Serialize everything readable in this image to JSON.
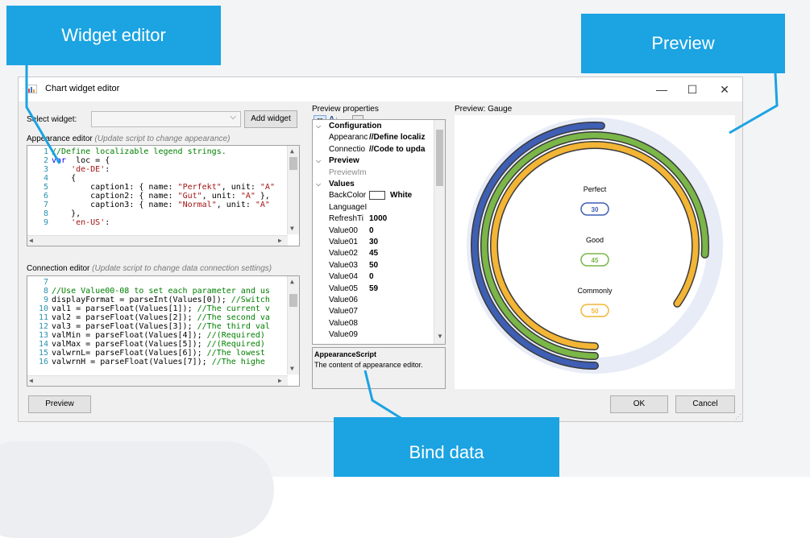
{
  "callouts": {
    "widget_editor": "Widget editor",
    "preview": "Preview",
    "bind_data": "Bind data"
  },
  "window": {
    "title": "Chart widget editor",
    "minimize": "—",
    "maximize": "☐",
    "close": "✕"
  },
  "select_widget": {
    "label": "Select widget:",
    "value": "",
    "add_button": "Add widget"
  },
  "appearance": {
    "label": "Appearance editor",
    "hint": "(Update script to change appearance)",
    "lines": [
      {
        "n": "1",
        "parts": [
          [
            "cm",
            "//Define localizable legend strings."
          ]
        ]
      },
      {
        "n": "2",
        "parts": [
          [
            "kw",
            "var"
          ],
          [
            "",
            "  loc = {"
          ]
        ]
      },
      {
        "n": "3",
        "parts": [
          [
            "st",
            "    'de-DE'"
          ],
          [
            "",
            ":"
          ]
        ]
      },
      {
        "n": "4",
        "parts": [
          [
            "",
            "    {"
          ]
        ]
      },
      {
        "n": "5",
        "parts": [
          [
            "",
            "        caption1: { name: "
          ],
          [
            "st",
            "\"Perfekt\""
          ],
          [
            "",
            ", unit: "
          ],
          [
            "st",
            "\"A\""
          ]
        ]
      },
      {
        "n": "6",
        "parts": [
          [
            "",
            "        caption2: { name: "
          ],
          [
            "st",
            "\"Gut\""
          ],
          [
            "",
            ", unit: "
          ],
          [
            "st",
            "\"A\""
          ],
          [
            "",
            " },"
          ]
        ]
      },
      {
        "n": "7",
        "parts": [
          [
            "",
            "        caption3: { name: "
          ],
          [
            "st",
            "\"Normal\""
          ],
          [
            "",
            ", unit: "
          ],
          [
            "st",
            "\"A\""
          ]
        ]
      },
      {
        "n": "8",
        "parts": [
          [
            "",
            "    },"
          ]
        ]
      },
      {
        "n": "9",
        "parts": [
          [
            "st",
            "    'en-US'"
          ],
          [
            "",
            ":"
          ]
        ]
      }
    ]
  },
  "connection": {
    "label": "Connection editor",
    "hint": "(Update script to change data connection settings)",
    "lines": [
      {
        "n": "7",
        "parts": []
      },
      {
        "n": "8",
        "parts": [
          [
            "cm",
            "//Use Value00-08 to set each parameter and us"
          ]
        ]
      },
      {
        "n": "9",
        "parts": [
          [
            "",
            "displayFormat = parseInt(Values[0]); "
          ],
          [
            "cm",
            "//Switch"
          ]
        ]
      },
      {
        "n": "10",
        "parts": [
          [
            "",
            "val1 = parseFloat(Values[1]); "
          ],
          [
            "cm",
            "//The current v"
          ]
        ]
      },
      {
        "n": "11",
        "parts": [
          [
            "",
            "val2 = parseFloat(Values[2]); "
          ],
          [
            "cm",
            "//The second va"
          ]
        ]
      },
      {
        "n": "12",
        "parts": [
          [
            "",
            "val3 = parseFloat(Values[3]); "
          ],
          [
            "cm",
            "//The third val"
          ]
        ]
      },
      {
        "n": "13",
        "parts": [
          [
            "",
            "valMin = parseFloat(Values[4]); "
          ],
          [
            "cm",
            "//(Required)"
          ]
        ]
      },
      {
        "n": "14",
        "parts": [
          [
            "",
            "valMax = parseFloat(Values[5]); "
          ],
          [
            "cm",
            "//(Required)"
          ]
        ]
      },
      {
        "n": "15",
        "parts": [
          [
            "",
            "valwrnL= parseFloat(Values[6]); "
          ],
          [
            "cm",
            "//The lowest"
          ]
        ]
      },
      {
        "n": "16",
        "parts": [
          [
            "",
            "valwrnH = parseFloat(Values[7]); "
          ],
          [
            "cm",
            "//The highe"
          ]
        ]
      }
    ]
  },
  "preview_button": "Preview",
  "properties": {
    "label": "Preview properties",
    "rows": [
      {
        "type": "cat",
        "name": "Configuration"
      },
      {
        "type": "prop",
        "name": "Appearanc",
        "value": "//Define localiz"
      },
      {
        "type": "prop",
        "name": "Connectio",
        "value": "//Code to upda"
      },
      {
        "type": "cat",
        "name": "Preview"
      },
      {
        "type": "prop",
        "name": "PreviewIm",
        "value": "",
        "grey": true
      },
      {
        "type": "cat",
        "name": "Values"
      },
      {
        "type": "color",
        "name": "BackColor",
        "value": "White"
      },
      {
        "type": "prop",
        "name": "LanguageI",
        "value": ""
      },
      {
        "type": "prop",
        "name": "RefreshTi",
        "value": "1000"
      },
      {
        "type": "prop",
        "name": "Value00",
        "value": "0"
      },
      {
        "type": "prop",
        "name": "Value01",
        "value": "30"
      },
      {
        "type": "prop",
        "name": "Value02",
        "value": "45"
      },
      {
        "type": "prop",
        "name": "Value03",
        "value": "50"
      },
      {
        "type": "prop",
        "name": "Value04",
        "value": "0"
      },
      {
        "type": "prop",
        "name": "Value05",
        "value": "59"
      },
      {
        "type": "prop",
        "name": "Value06",
        "value": ""
      },
      {
        "type": "prop",
        "name": "Value07",
        "value": ""
      },
      {
        "type": "prop",
        "name": "Value08",
        "value": ""
      },
      {
        "type": "prop",
        "name": "Value09",
        "value": ""
      }
    ],
    "desc_title": "AppearanceScript",
    "desc_text": "The content of appearance editor."
  },
  "preview": {
    "label": "Preview: Gauge",
    "legend": [
      {
        "name": "Perfect",
        "value": "30",
        "color": "#3f5fb5"
      },
      {
        "name": "Good",
        "value": "45",
        "color": "#7ab648"
      },
      {
        "name": "Commonly",
        "value": "50",
        "color": "#f3b535"
      }
    ]
  },
  "chart_data": {
    "type": "gauge",
    "series": [
      {
        "name": "Perfect",
        "value": 30,
        "color": "#3f5fb5"
      },
      {
        "name": "Good",
        "value": 45,
        "color": "#7ab648"
      },
      {
        "name": "Commonly",
        "value": 50,
        "color": "#f3b535"
      }
    ],
    "min": 0,
    "max": 59,
    "track_color": "#e7ecf7"
  },
  "ok_button": "OK",
  "cancel_button": "Cancel"
}
